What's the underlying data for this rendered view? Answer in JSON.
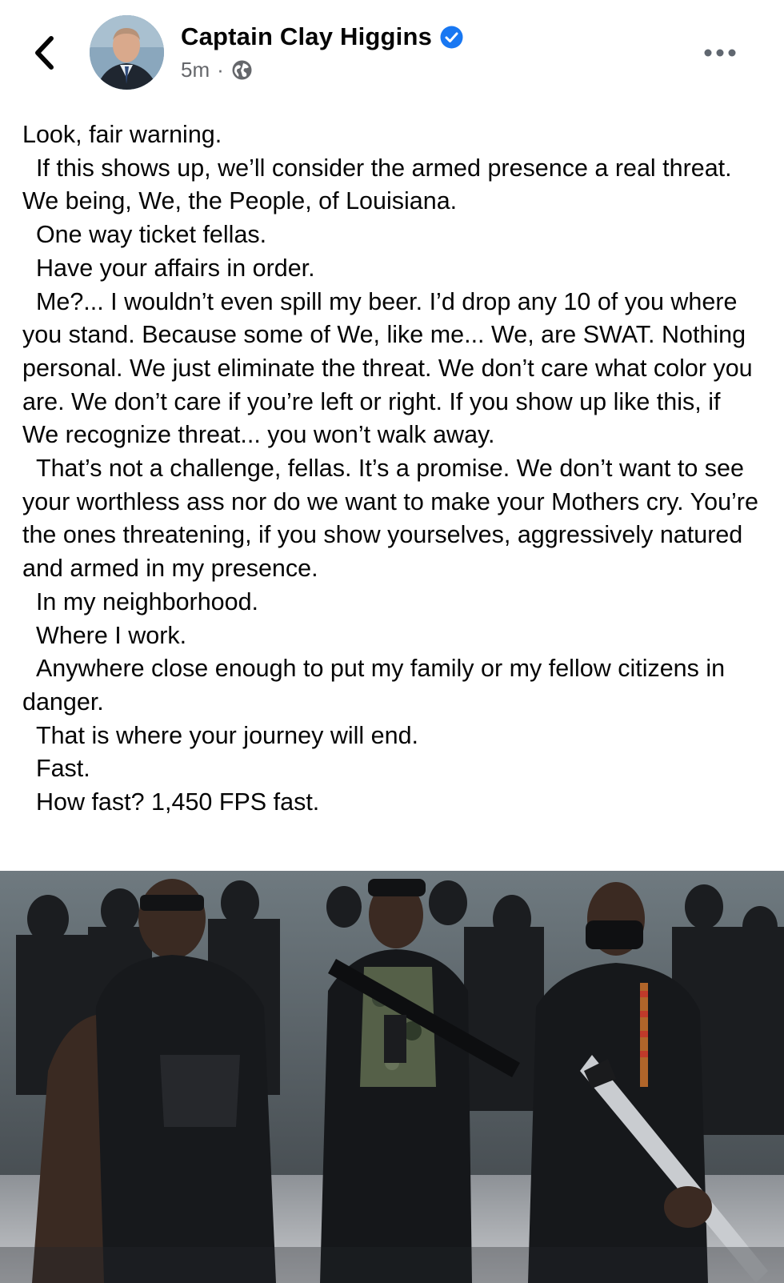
{
  "post": {
    "author_name": "Captain Clay Higgins",
    "timestamp": "5m",
    "separator": "·",
    "audience_icon": "globe-icon",
    "verified_icon": "verified-badge-icon",
    "verified_color": "#1877f2",
    "paragraphs": [
      "Look, fair warning.",
      "  If this shows up, we’ll consider the armed presence a real threat. We being, We, the People, of Louisiana.",
      "  One way ticket fellas.",
      "  Have your affairs in order.",
      "  Me?... I wouldn’t even spill my beer. I’d drop any 10 of you where you stand. Because some of We, like me... We, are SWAT. Nothing personal. We just eliminate the threat. We don’t care what color you are. We don’t care if you’re left or right. If you show up like this, if We recognize threat... you won’t walk away.",
      "  That’s not a challenge, fellas. It’s a promise. We don’t want to see your worthless ass nor do we want to make your Mothers cry. You’re the ones threatening, if you show yourselves, aggressively natured and armed in my presence.",
      "  In my neighborhood.",
      "  Where I work.",
      "  Anywhere close enough to put my family or my fellow citizens in danger.",
      "  That is where your journey will end.",
      "  Fast.",
      "  How fast? 1,450 FPS fast."
    ]
  },
  "header": {
    "back_icon": "chevron-left-icon",
    "more_icon": "more-horizontal-icon"
  },
  "colors": {
    "text": "#050505",
    "secondary_text": "#65676b",
    "background": "#ffffff"
  }
}
